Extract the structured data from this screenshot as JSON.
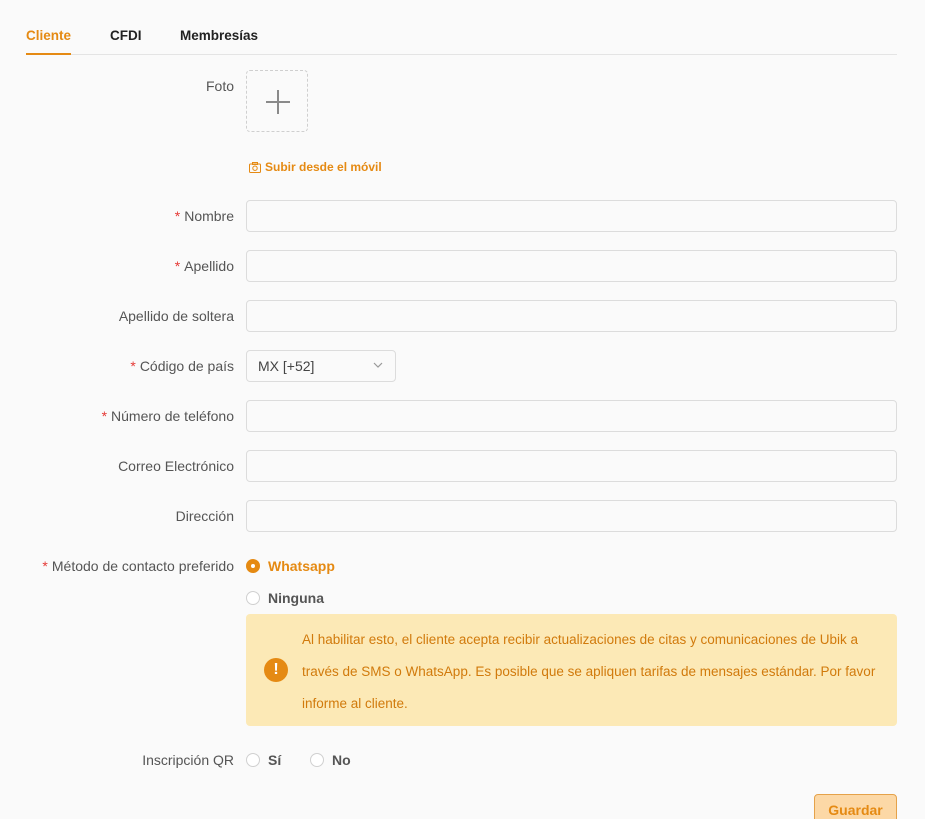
{
  "tabs": [
    {
      "label": "Cliente",
      "active": true
    },
    {
      "label": "CFDI",
      "active": false
    },
    {
      "label": "Membresías",
      "active": false
    }
  ],
  "form": {
    "photo_label": "Foto",
    "mobile_upload": "Subir desde el móvil",
    "required_mark": "*",
    "first_name_label": "Nombre",
    "last_name_label": "Apellido",
    "maiden_name_label": "Apellido de soltera",
    "country_code_label": "Código de país",
    "country_code_value": "MX [+52]",
    "phone_label": "Número de teléfono",
    "email_label": "Correo Electrónico",
    "address_label": "Dirección",
    "contact_method_label": "Método de contacto preferido",
    "contact_options": [
      {
        "label": "Whatsapp",
        "selected": true
      },
      {
        "label": "Ninguna",
        "selected": false
      }
    ],
    "alert_text": "Al habilitar esto, el cliente acepta recibir actualizaciones de citas y comunicaciones de Ubik a través de SMS o WhatsApp. Es posible que se apliquen tarifas de mensajes estándar. Por favor informe al cliente.",
    "alert_icon": "!",
    "qr_label": "Inscripción QR",
    "qr_options": [
      {
        "label": "Sí",
        "selected": false
      },
      {
        "label": "No",
        "selected": false
      }
    ],
    "save_label": "Guardar"
  },
  "colors": {
    "accent": "#e58a13",
    "required": "#e53935",
    "alert_bg": "#fce9b6"
  }
}
